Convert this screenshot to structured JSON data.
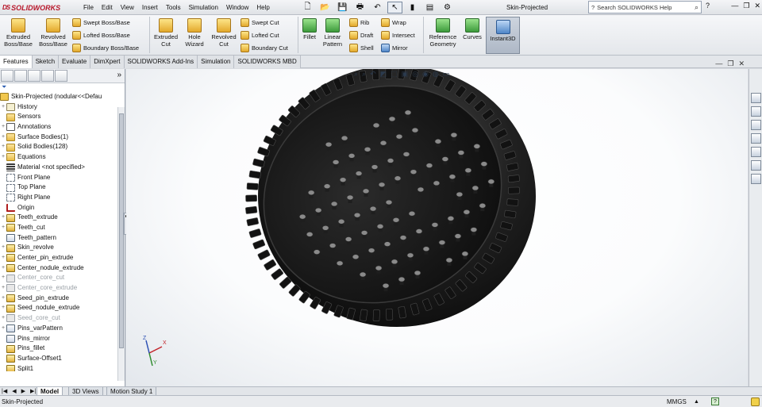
{
  "app": {
    "logo_text": "SOLIDWORKS",
    "logo_mark": "DS",
    "document_title": "Skin-Projected"
  },
  "menu": [
    "File",
    "Edit",
    "View",
    "Insert",
    "Tools",
    "Simulation",
    "Window",
    "Help"
  ],
  "search": {
    "placeholder": "Search SOLIDWORKS Help",
    "icon": "search-icon"
  },
  "ribbon": {
    "extruded_boss": "Extruded\nBoss/Base",
    "revolved_boss": "Revolved\nBoss/Base",
    "swept_boss": "Swept Boss/Base",
    "lofted_boss": "Lofted Boss/Base",
    "boundary_boss": "Boundary Boss/Base",
    "extruded_cut": "Extruded\nCut",
    "hole_wizard": "Hole\nWizard",
    "revolved_cut": "Revolved\nCut",
    "swept_cut": "Swept Cut",
    "lofted_cut": "Lofted Cut",
    "boundary_cut": "Boundary Cut",
    "fillet": "Fillet",
    "linear_pattern": "Linear\nPattern",
    "rib": "Rib",
    "draft": "Draft",
    "shell": "Shell",
    "wrap": "Wrap",
    "intersect": "Intersect",
    "mirror": "Mirror",
    "reference_geometry": "Reference\nGeometry",
    "curves": "Curves",
    "instant3d": "Instant3D"
  },
  "command_tabs": [
    {
      "label": "Features",
      "active": true
    },
    {
      "label": "Sketch",
      "active": false
    },
    {
      "label": "Evaluate",
      "active": false
    },
    {
      "label": "DimXpert",
      "active": false
    },
    {
      "label": "SOLIDWORKS Add-Ins",
      "active": false
    },
    {
      "label": "Simulation",
      "active": false
    },
    {
      "label": "SOLIDWORKS MBD",
      "active": false
    }
  ],
  "tree": {
    "root": "Skin-Projected  (nodular<<Defau",
    "items": [
      {
        "label": "History",
        "icon": "hist",
        "exp": "+",
        "grey": false
      },
      {
        "label": "Sensors",
        "icon": "folder",
        "exp": "",
        "grey": false
      },
      {
        "label": "Annotations",
        "icon": "annot",
        "exp": "+",
        "grey": false
      },
      {
        "label": "Surface Bodies(1)",
        "icon": "folder",
        "exp": "+",
        "grey": false
      },
      {
        "label": "Solid Bodies(128)",
        "icon": "folder",
        "exp": "+",
        "grey": false
      },
      {
        "label": "Equations",
        "icon": "folder",
        "exp": "+",
        "grey": false
      },
      {
        "label": "Material <not specified>",
        "icon": "mat",
        "exp": "",
        "grey": false
      },
      {
        "label": "Front Plane",
        "icon": "plane",
        "exp": "",
        "grey": false
      },
      {
        "label": "Top Plane",
        "icon": "plane",
        "exp": "",
        "grey": false
      },
      {
        "label": "Right Plane",
        "icon": "plane",
        "exp": "",
        "grey": false
      },
      {
        "label": "Origin",
        "icon": "origin",
        "exp": "",
        "grey": false
      },
      {
        "label": "Teeth_extrude",
        "icon": "feat",
        "exp": "+",
        "grey": false
      },
      {
        "label": "Teeth_cut",
        "icon": "feat",
        "exp": "+",
        "grey": false
      },
      {
        "label": "Teeth_pattern",
        "icon": "pat",
        "exp": "",
        "grey": false
      },
      {
        "label": "Skin_revolve",
        "icon": "feat",
        "exp": "+",
        "grey": false
      },
      {
        "label": "Center_pin_extrude",
        "icon": "feat",
        "exp": "+",
        "grey": false
      },
      {
        "label": "Center_nodule_extrude",
        "icon": "feat",
        "exp": "+",
        "grey": false
      },
      {
        "label": "Center_core_cut",
        "icon": "featg",
        "exp": "+",
        "grey": true
      },
      {
        "label": "Center_core_extrude",
        "icon": "featg",
        "exp": "+",
        "grey": true
      },
      {
        "label": "Seed_pin_extrude",
        "icon": "feat",
        "exp": "+",
        "grey": false
      },
      {
        "label": "Seed_nodule_extrude",
        "icon": "feat",
        "exp": "+",
        "grey": false
      },
      {
        "label": "Seed_core_cut",
        "icon": "featg",
        "exp": "+",
        "grey": true
      },
      {
        "label": "Pins_varPattern",
        "icon": "pat",
        "exp": "+",
        "grey": false
      },
      {
        "label": "Pins_mirror",
        "icon": "pat",
        "exp": "",
        "grey": false
      },
      {
        "label": "Pins_fillet",
        "icon": "feat",
        "exp": "",
        "grey": false
      },
      {
        "label": "Surface-Offset1",
        "icon": "feat",
        "exp": "",
        "grey": false
      },
      {
        "label": "Split1",
        "icon": "feat",
        "exp": "",
        "grey": false
      }
    ]
  },
  "bottom_tabs": [
    {
      "label": "Model",
      "active": true
    },
    {
      "label": "3D Views",
      "active": false
    },
    {
      "label": "Motion Study 1",
      "active": false
    }
  ],
  "status": {
    "left": "Skin-Projected",
    "units": "MMGS",
    "units_arrow": "▲",
    "help": "?"
  },
  "triad": {
    "x": "X",
    "y": "Y",
    "z": "Z"
  },
  "colors": {
    "accent": "#b8172a",
    "model": "#1a1a1a",
    "panel_bg": "#ffffff"
  }
}
